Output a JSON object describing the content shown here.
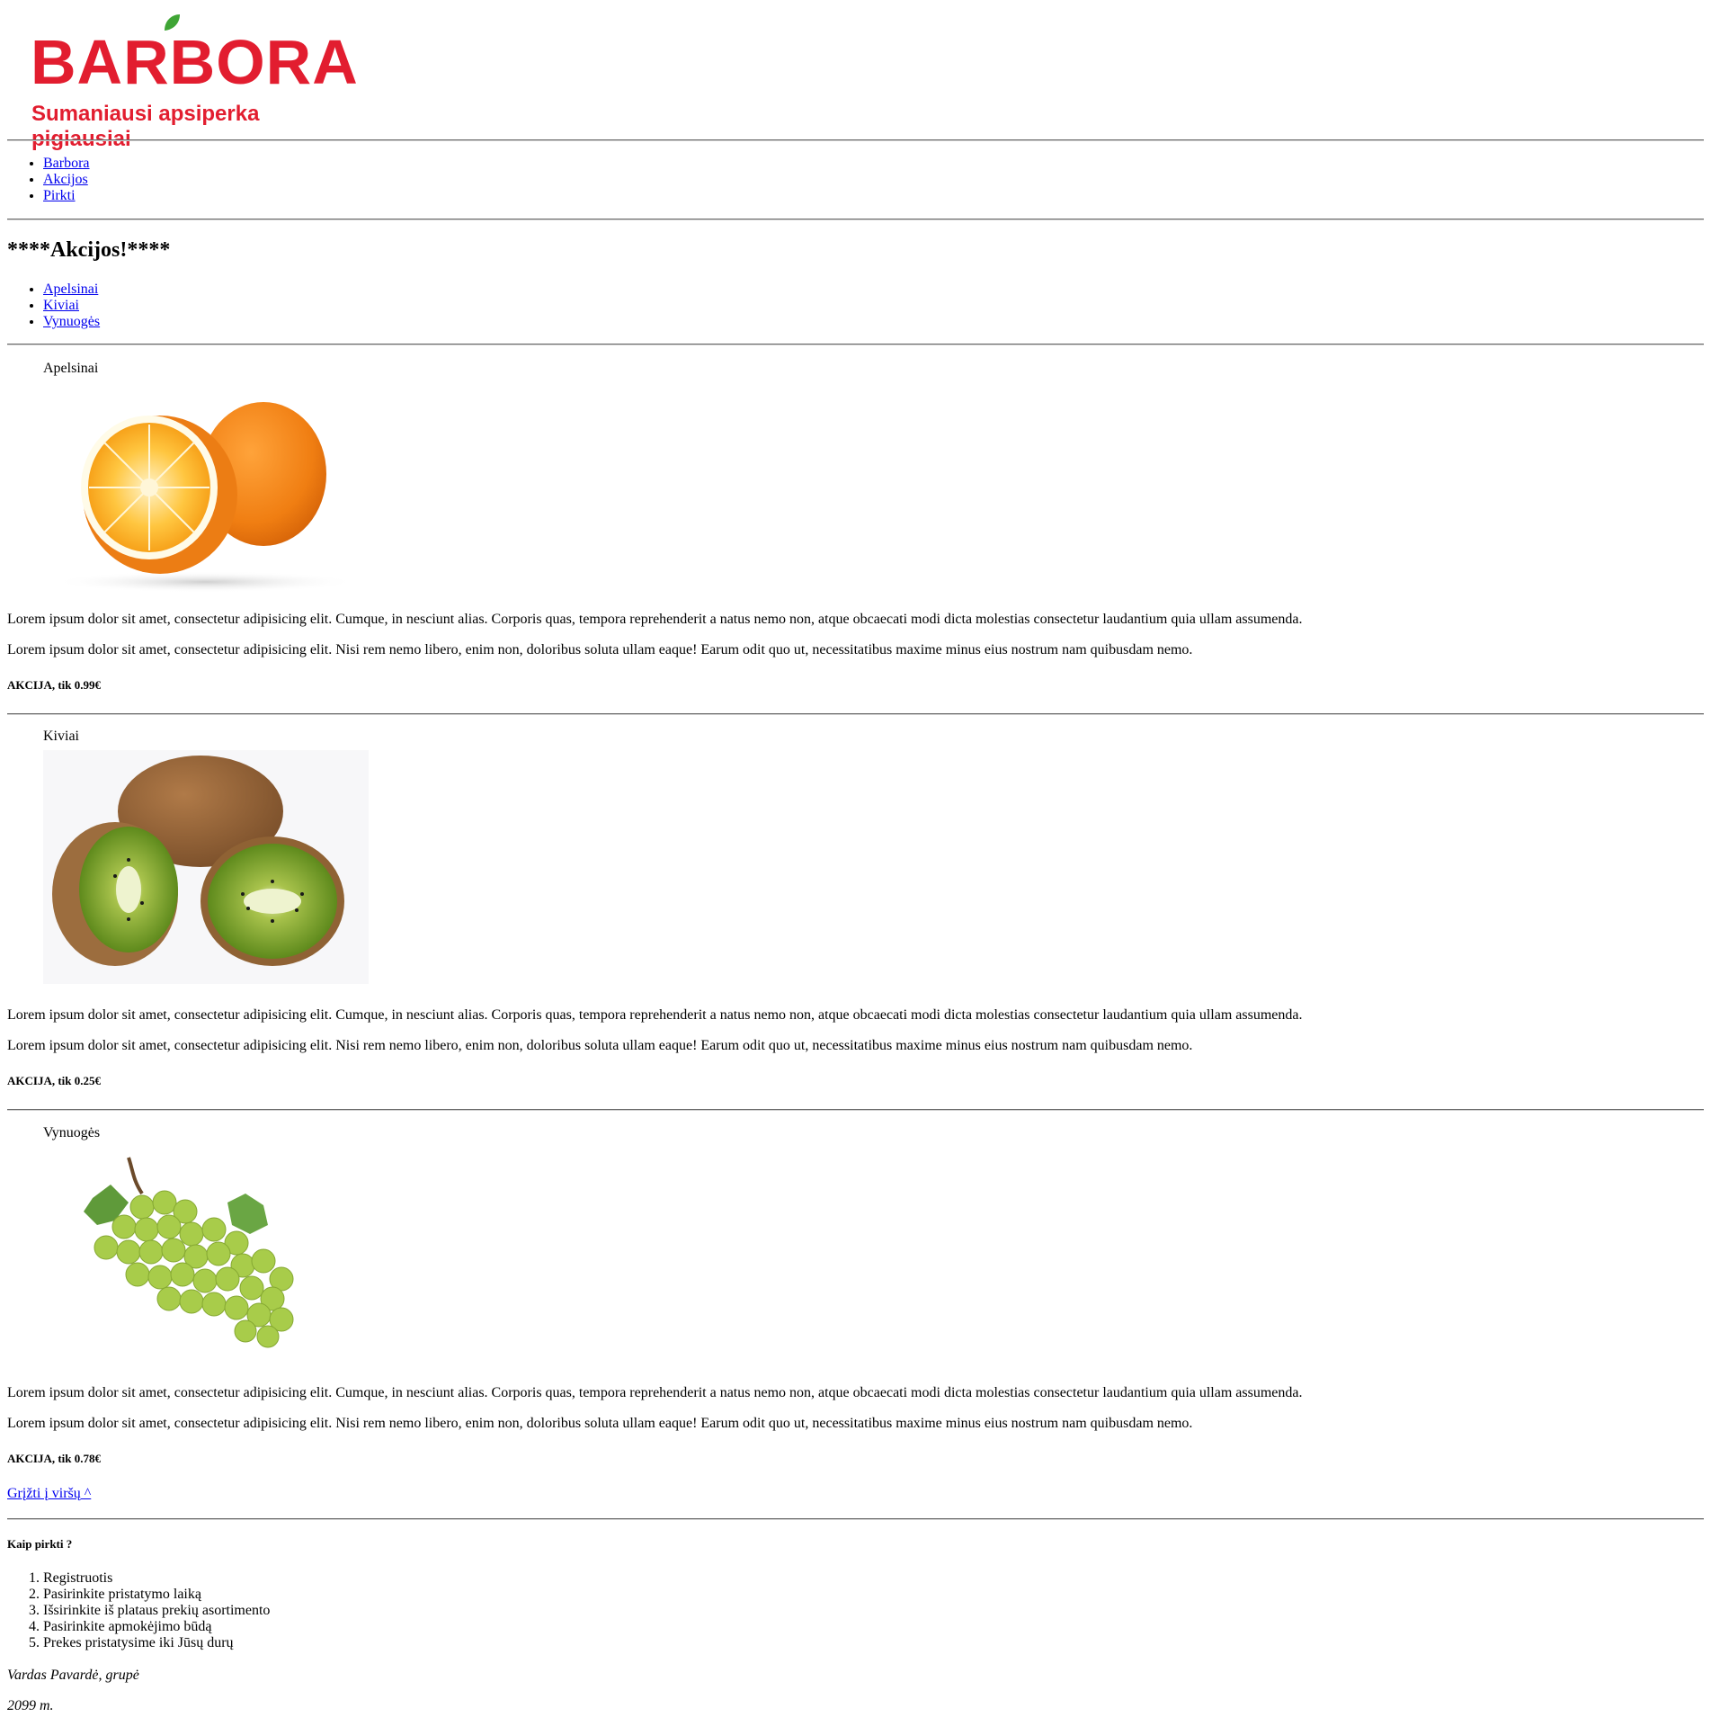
{
  "logo": {
    "word": "BARBORA",
    "tagline": "Sumaniausi apsiperka pigiausiai",
    "brand_color": "#e21d2f",
    "leaf_color": "#3fa535"
  },
  "nav": {
    "items": [
      "Barbora",
      "Akcijos",
      "Pirkti"
    ]
  },
  "promo": {
    "heading": "****Akcijos!****",
    "links": [
      "Apelsinai",
      "Kiviai",
      "Vynuogės"
    ]
  },
  "products": [
    {
      "name": "Apelsinai",
      "image": "orange-image",
      "text1": "Lorem ipsum dolor sit amet, consectetur adipisicing elit. Cumque, in nesciunt alias. Corporis quas, tempora reprehenderit a natus nemo non, atque obcaecati modi dicta molestias consectetur laudantium quia ullam assumenda.",
      "text2": "Lorem ipsum dolor sit amet, consectetur adipisicing elit. Nisi rem nemo libero, enim non, doloribus soluta ullam eaque! Earum odit quo ut, necessitatibus maxime minus eius nostrum nam quibusdam nemo.",
      "price": "AKCIJA, tik 0.99€"
    },
    {
      "name": "Kiviai",
      "image": "kiwi-image",
      "text1": "Lorem ipsum dolor sit amet, consectetur adipisicing elit. Cumque, in nesciunt alias. Corporis quas, tempora reprehenderit a natus nemo non, atque obcaecati modi dicta molestias consectetur laudantium quia ullam assumenda.",
      "text2": "Lorem ipsum dolor sit amet, consectetur adipisicing elit. Nisi rem nemo libero, enim non, doloribus soluta ullam eaque! Earum odit quo ut, necessitatibus maxime minus eius nostrum nam quibusdam nemo.",
      "price": "AKCIJA, tik 0.25€"
    },
    {
      "name": "Vynuogės",
      "image": "grapes-image",
      "text1": "Lorem ipsum dolor sit amet, consectetur adipisicing elit. Cumque, in nesciunt alias. Corporis quas, tempora reprehenderit a natus nemo non, atque obcaecati modi dicta molestias consectetur laudantium quia ullam assumenda.",
      "text2": "Lorem ipsum dolor sit amet, consectetur adipisicing elit. Nisi rem nemo libero, enim non, doloribus soluta ullam eaque! Earum odit quo ut, necessitatibus maxime minus eius nostrum nam quibusdam nemo.",
      "price": "AKCIJA, tik 0.78€"
    }
  ],
  "back_to_top": "Grįžti į viršų ^",
  "howto": {
    "title": "Kaip pirkti ?",
    "steps": [
      "Registruotis",
      "Pasirinkite pristatymo laiką",
      "Išsirinkite iš plataus prekių asortimento",
      "Pasirinkite apmokėjimo būdą",
      "Prekes pristatysime iki Jūsų durų"
    ]
  },
  "footer": {
    "author": "Vardas Pavardė, grupė",
    "year": "2099 m."
  }
}
